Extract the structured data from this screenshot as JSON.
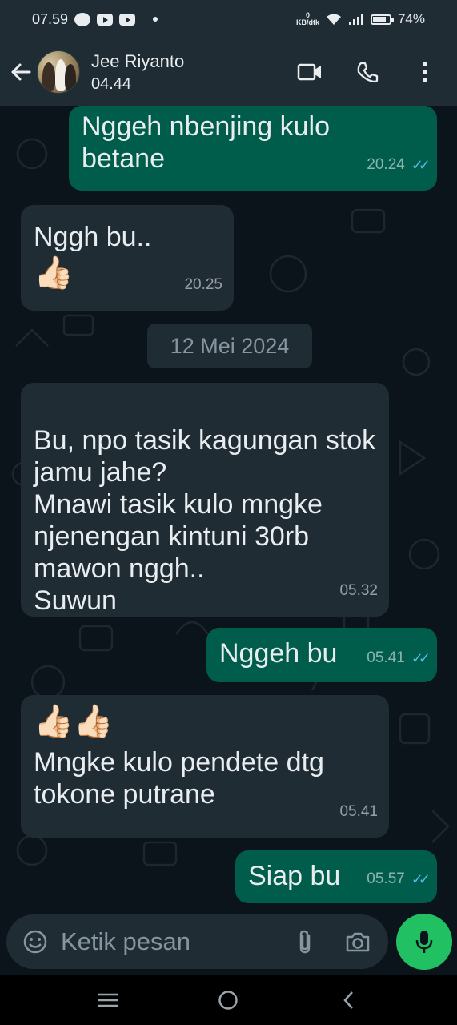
{
  "status_bar": {
    "time": "07.59",
    "net_speed_value": "0",
    "net_speed_unit": "KB/dtk",
    "battery": "74%",
    "icons": [
      "message-bubble-icon",
      "youtube-icon",
      "youtube-icon",
      "dot-icon",
      "wifi-icon",
      "signal-icon",
      "battery-icon"
    ]
  },
  "header": {
    "contact_name": "Jee Riyanto",
    "last_seen": "04.44",
    "icons": [
      "back-arrow-icon",
      "video-call-icon",
      "phone-icon",
      "more-vert-icon"
    ]
  },
  "messages": [
    {
      "direction": "out",
      "text": "Nggeh nbenjing kulo betane",
      "time": "20.24",
      "read": true
    },
    {
      "direction": "in",
      "text": "Nggh bu..",
      "emoji": "👍🏻",
      "time": "20.25"
    },
    {
      "direction": "date",
      "text": "12 Mei 2024"
    },
    {
      "direction": "in",
      "text": "Bu, npo tasik kagungan stok jamu jahe?\nMnawi tasik kulo mngke njenengan kintuni 30rb mawon nggh..\nSuwun",
      "time": "05.32"
    },
    {
      "direction": "out",
      "text": "Nggeh bu",
      "time": "05.41",
      "read": true
    },
    {
      "direction": "in",
      "emoji": "👍🏻👍🏻",
      "text": "Mngke kulo pendete dtg tokone putrane",
      "time": "05.41"
    },
    {
      "direction": "out",
      "text": "Siap bu",
      "time": "05.57",
      "read": true
    }
  ],
  "composer": {
    "placeholder": "Ketik pesan",
    "value": ""
  },
  "colors": {
    "background": "#0b141a",
    "incoming_bubble": "#1f2c34",
    "outgoing_bubble": "#005c4b",
    "read_ticks": "#53bdeb",
    "mic_button": "#21c063"
  }
}
